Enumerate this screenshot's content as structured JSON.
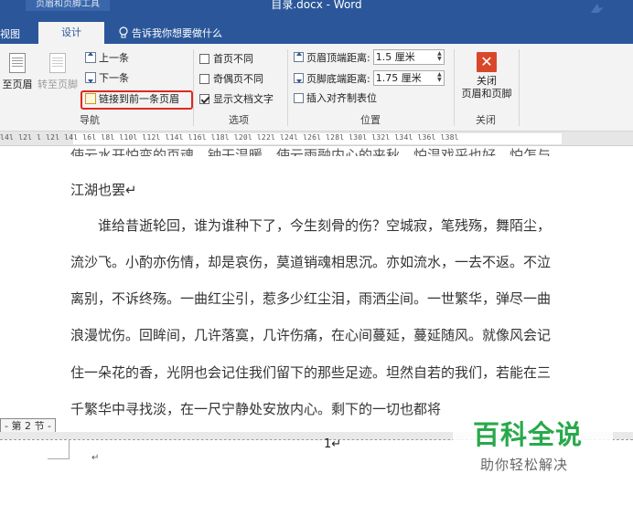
{
  "window": {
    "context_tab": "页眉和页脚工具",
    "title": "目录.docx - Word"
  },
  "tabs": {
    "view_partial": "视图",
    "design": "设计",
    "tell_me": "告诉我你想要做什么"
  },
  "ribbon": {
    "navigation": {
      "goto_header": "至页眉",
      "goto_footer": "转至页脚",
      "previous": "上一条",
      "next": "下一条",
      "link_to_previous": "链接到前一条页眉",
      "label": "导航"
    },
    "options": {
      "different_first_page": "首页不同",
      "different_odd_even": "奇偶页不同",
      "show_document_text": "显示文档文字",
      "different_first_page_checked": false,
      "different_odd_even_checked": false,
      "show_document_text_checked": true,
      "label": "选项"
    },
    "position": {
      "header_from_top_label": "页眉顶端距离:",
      "header_from_top_value": "1.5 厘米",
      "footer_from_bottom_label": "页脚底端距离:",
      "footer_from_bottom_value": "1.75 厘米",
      "insert_alignment_tab": "插入对齐制表位",
      "label": "位置"
    },
    "close": {
      "button_line1": "关闭",
      "button_line2": "页眉和页脚",
      "label": "关闭"
    }
  },
  "ruler": {
    "ticks": "l4l  l2l  l    l2l  l4l  l6l  l8l  l10l  l12l  l14l  l16l  l18l  l20l  l22l  l24l  l26l  l28l  l30l  l32l  l34l  l36l  l38l"
  },
  "document": {
    "cut_line": "使云水开怕变的页魂，钟干温暖，使云雨融内心的来秋。怕温戏采也好，怕怎与",
    "lines": [
      "江湖也罢↵",
      "　　谁给昔逝轮回，谁为谁种下了，今生刻骨的伤？空城寂，笔残殇，舞陌尘，",
      "流沙飞。小酌亦伤情，却是哀伤，莫道销魂相思沉。亦如流水，一去不返。不泣",
      "离别，不诉终殇。一曲红尘引，惹多少红尘泪，雨洒尘间。一世繁华，弹尽一曲",
      "浪漫忧伤。回眸间，几许落寞，几许伤痛，在心间蔓延，蔓延随风。就像风会记",
      "住一朵花的香，光阴也会记住我们留下的那些足迹。坦然自若的我们，若能在三",
      "千繁华中寻找淡，在一尺宁静处安放内心。剩下的一切也都将"
    ],
    "section_tag": "- 第 2 节 -",
    "cursor_text": "1↵",
    "paragraph_mark": "↵"
  },
  "watermark": {
    "title": "百科全说",
    "subtitle": "助你轻松解决"
  }
}
